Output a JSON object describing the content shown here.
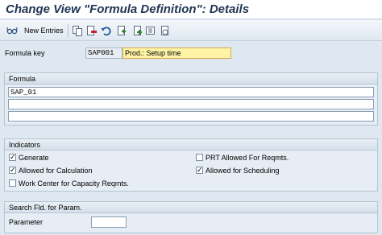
{
  "window": {
    "title": "Change View \"Formula Definition\": Details"
  },
  "toolbar": {
    "new_entries_label": "New Entries",
    "icons": [
      "glasses-icon",
      "copy-icon",
      "delete-icon",
      "undo-icon",
      "select-all-icon",
      "first-entry-icon",
      "previous-entry-icon",
      "next-entry-icon",
      "last-entry-icon"
    ]
  },
  "header": {
    "formula_key_label": "Formula key",
    "formula_key_value": "SAP001",
    "description_value": "Prod.: Setup time"
  },
  "formula": {
    "title": "Formula",
    "lines": [
      "SAP_01",
      "",
      ""
    ]
  },
  "indicators": {
    "title": "Indicators",
    "items": [
      {
        "label": "Generate",
        "checked": true
      },
      {
        "label": "Allowed for Calculation",
        "checked": true
      },
      {
        "label": "Work Center for Capacity Reqmts.",
        "checked": false
      },
      {
        "label": "PRT Allowed For Reqmts.",
        "checked": false
      },
      {
        "label": "Allowed for Scheduling",
        "checked": true
      }
    ],
    "check_glyph": "✓"
  },
  "search": {
    "title": "Search Fld. for Param.",
    "parameter_label": "Parameter",
    "parameter_value": ""
  }
}
